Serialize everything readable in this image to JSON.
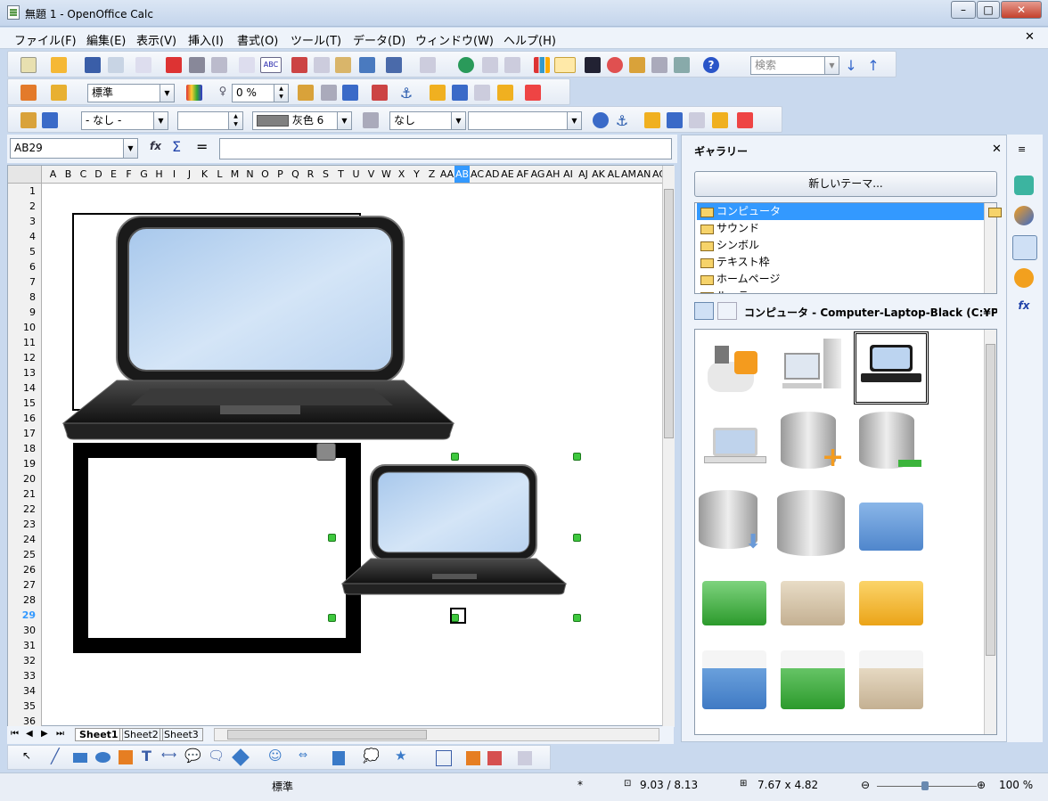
{
  "window": {
    "title": "無題 1 - OpenOffice Calc"
  },
  "menu": [
    "ファイル(F)",
    "編集(E)",
    "表示(V)",
    "挿入(I)",
    "書式(O)",
    "ツール(T)",
    "データ(D)",
    "ウィンドウ(W)",
    "ヘルプ(H)"
  ],
  "toolbar1": {
    "search_placeholder": "検索"
  },
  "toolbar2": {
    "paragraph_style": "標準",
    "percent": "0 %"
  },
  "toolbar3": {
    "line_style": "- なし -",
    "line_color": "灰色 6",
    "area_style": "なし",
    "area_value": ""
  },
  "formula": {
    "namebox": "AB29",
    "input": ""
  },
  "columns": [
    "A",
    "B",
    "C",
    "D",
    "E",
    "F",
    "G",
    "H",
    "I",
    "J",
    "K",
    "L",
    "M",
    "N",
    "O",
    "P",
    "Q",
    "R",
    "S",
    "T",
    "U",
    "V",
    "W",
    "X",
    "Y",
    "Z",
    "AA",
    "AB",
    "AC",
    "AD",
    "AE",
    "AF",
    "AG",
    "AH",
    "AI",
    "AJ",
    "AK",
    "AL",
    "AM",
    "AN",
    "AC"
  ],
  "active_column": "AB",
  "rows": [
    "1",
    "2",
    "3",
    "4",
    "5",
    "6",
    "7",
    "8",
    "9",
    "10",
    "11",
    "12",
    "13",
    "14",
    "15",
    "16",
    "17",
    "18",
    "19",
    "20",
    "21",
    "22",
    "23",
    "24",
    "25",
    "26",
    "27",
    "28",
    "29",
    "30",
    "31",
    "32",
    "33",
    "34",
    "35",
    "36"
  ],
  "active_row": "29",
  "sheets": [
    "Sheet1",
    "Sheet2",
    "Sheet3"
  ],
  "gallery": {
    "title": "ギャラリー",
    "new_theme": "新しいテーマ...",
    "themes": [
      "コンピュータ",
      "サウンド",
      "シンボル",
      "テキスト枠",
      "ホームページ",
      "ルーラー"
    ],
    "selected_theme": "コンピュータ",
    "item_title": "コンピュータ - Computer-Laptop-Black (C:¥Pr"
  },
  "status": {
    "style": "標準",
    "modified": "*",
    "position": "9.03 / 8.13",
    "size": "7.67 x 4.82",
    "zoom": "100 %"
  },
  "colors": {
    "accent": "#3399ff",
    "handle": "#3ec83e"
  }
}
